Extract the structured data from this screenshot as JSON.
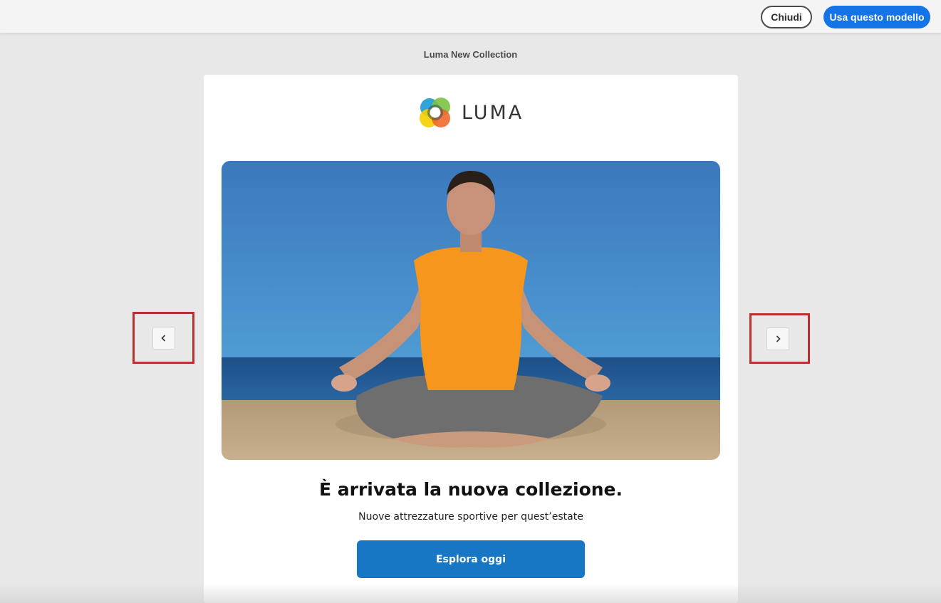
{
  "toolbar": {
    "close_label": "Chiudi",
    "use_template_label": "Usa questo modello"
  },
  "template": {
    "title": "Luma New Collection"
  },
  "email": {
    "logo_text": "LUMA",
    "headline": "È arrivata la nuova collezione.",
    "subline": "Nuove attrezzature sportive per quest’estate",
    "cta_label": "Esplora oggi"
  },
  "navigation": {
    "prev_icon": "chevron-left-icon",
    "next_icon": "chevron-right-icon"
  },
  "colors": {
    "accent": "#1473e6",
    "cta": "#1877c5",
    "highlight": "#b83232"
  }
}
